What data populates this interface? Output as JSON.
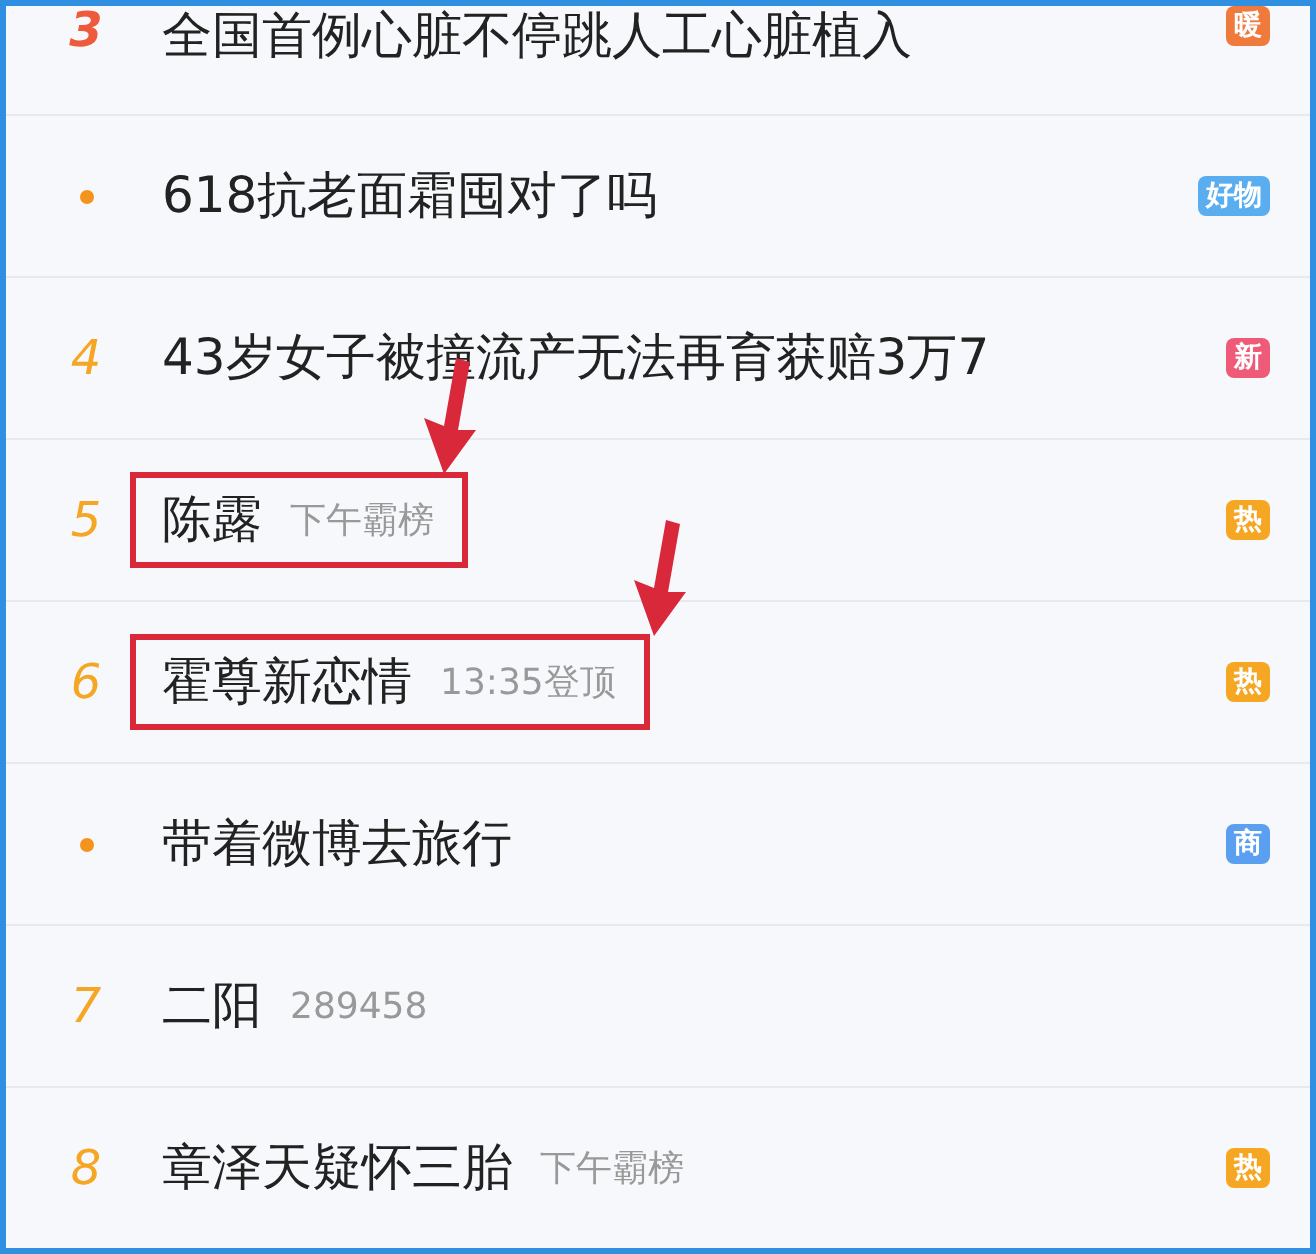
{
  "rows": [
    {
      "rank": {
        "kind": "number",
        "text": "3",
        "color": "#ee5a3c"
      },
      "title": "全国首例心脏不停跳人工心脏植入",
      "badge": {
        "text": "暖",
        "color": "#ef7a3c"
      },
      "highlighted": false
    },
    {
      "rank": {
        "kind": "dot",
        "color": "#f5931f"
      },
      "title": "618抗老面霜囤对了吗",
      "badge": {
        "text": "好物",
        "color": "#5aaef0"
      },
      "highlighted": false
    },
    {
      "rank": {
        "kind": "number",
        "text": "4",
        "color": "#f5a623"
      },
      "title": "43岁女子被撞流产无法再育获赔3万7",
      "badge": {
        "text": "新",
        "color": "#ef5a78"
      },
      "highlighted": false
    },
    {
      "rank": {
        "kind": "number",
        "text": "5",
        "color": "#f5a623"
      },
      "title": "陈露",
      "meta": "下午霸榜",
      "badge": {
        "text": "热",
        "color": "#f5a623"
      },
      "highlighted": true
    },
    {
      "rank": {
        "kind": "number",
        "text": "6",
        "color": "#f5a623"
      },
      "title": "霍尊新恋情",
      "meta": "13:35登顶",
      "badge": {
        "text": "热",
        "color": "#f5a623"
      },
      "highlighted": true
    },
    {
      "rank": {
        "kind": "dot",
        "color": "#f5931f"
      },
      "title": "带着微博去旅行",
      "badge": {
        "text": "商",
        "color": "#5a9ff0"
      },
      "highlighted": false
    },
    {
      "rank": {
        "kind": "number",
        "text": "7",
        "color": "#f5a623"
      },
      "title": "二阳",
      "meta": "289458",
      "highlighted": false
    },
    {
      "rank": {
        "kind": "number",
        "text": "8",
        "color": "#f5a623"
      },
      "title": "章泽天疑怀三胎",
      "meta": "下午霸榜",
      "badge": {
        "text": "热",
        "color": "#f5a623"
      },
      "highlighted": false
    }
  ]
}
